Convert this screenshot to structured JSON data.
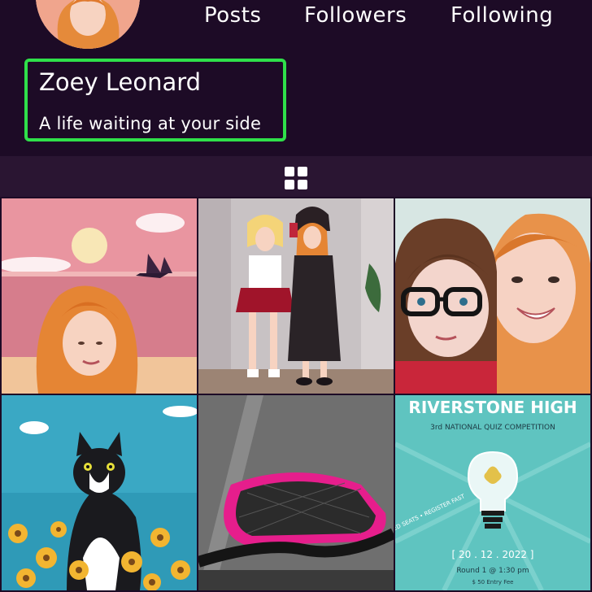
{
  "profile": {
    "name": "Zoey Leonard",
    "bio": "A life waiting at your side"
  },
  "stats": {
    "posts_label": "Posts",
    "followers_label": "Followers",
    "following_label": "Following"
  },
  "tabs": {
    "active_icon": "grid-icon"
  },
  "posts": [
    {
      "icon": "sunset-portrait-illustration"
    },
    {
      "icon": "two-girls-illustration"
    },
    {
      "icon": "selfie-illustration"
    },
    {
      "icon": "cat-in-flowers-illustration"
    },
    {
      "icon": "bicycle-photo"
    },
    {
      "icon": "quiz-poster",
      "title": "RIVERSTONE HIGH",
      "subtitle": "3rd NATIONAL QUIZ COMPETITION",
      "side_text": "LIMITED SEATS • REGISTER FAST",
      "date": "[ 20 . 12 . 2022 ]",
      "round": "Round 1 @ 1:30 pm",
      "fee": "$ 50 Entry Fee"
    }
  ],
  "colors": {
    "background": "#1d0b26",
    "tab_bar": "#2a1532",
    "highlight": "#2fe04a"
  }
}
